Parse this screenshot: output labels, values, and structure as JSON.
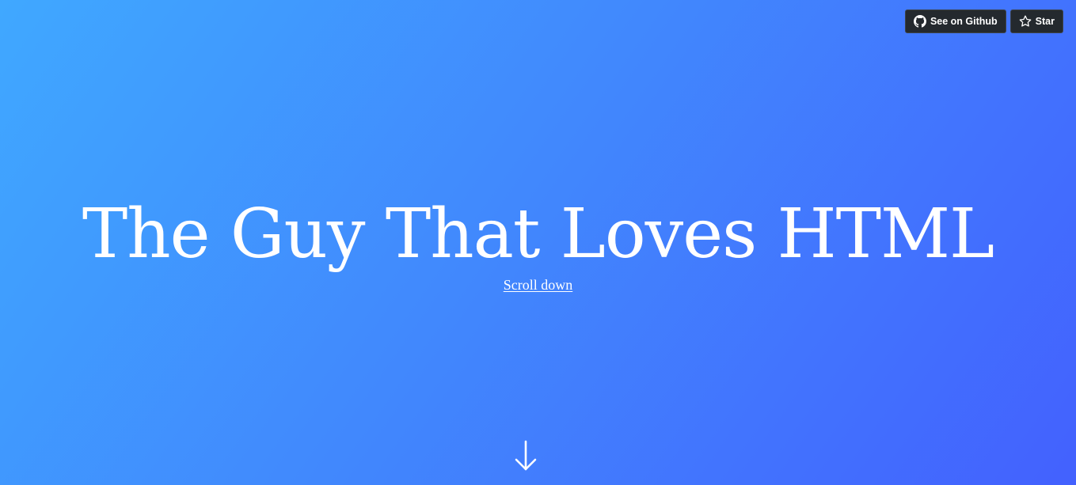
{
  "header": {
    "github_button": {
      "label": "See on Github",
      "icon": "github-icon"
    },
    "star_button": {
      "label": "Star",
      "icon": "star-icon"
    }
  },
  "hero": {
    "title": "The Guy That Loves HTML",
    "scroll_link": "Scroll down",
    "arrow_icon": "arrow-down-icon"
  },
  "colors": {
    "gradient_start": "#40a8ff",
    "gradient_end": "#4361fe",
    "button_bg": "#24292e",
    "text": "#ffffff"
  }
}
